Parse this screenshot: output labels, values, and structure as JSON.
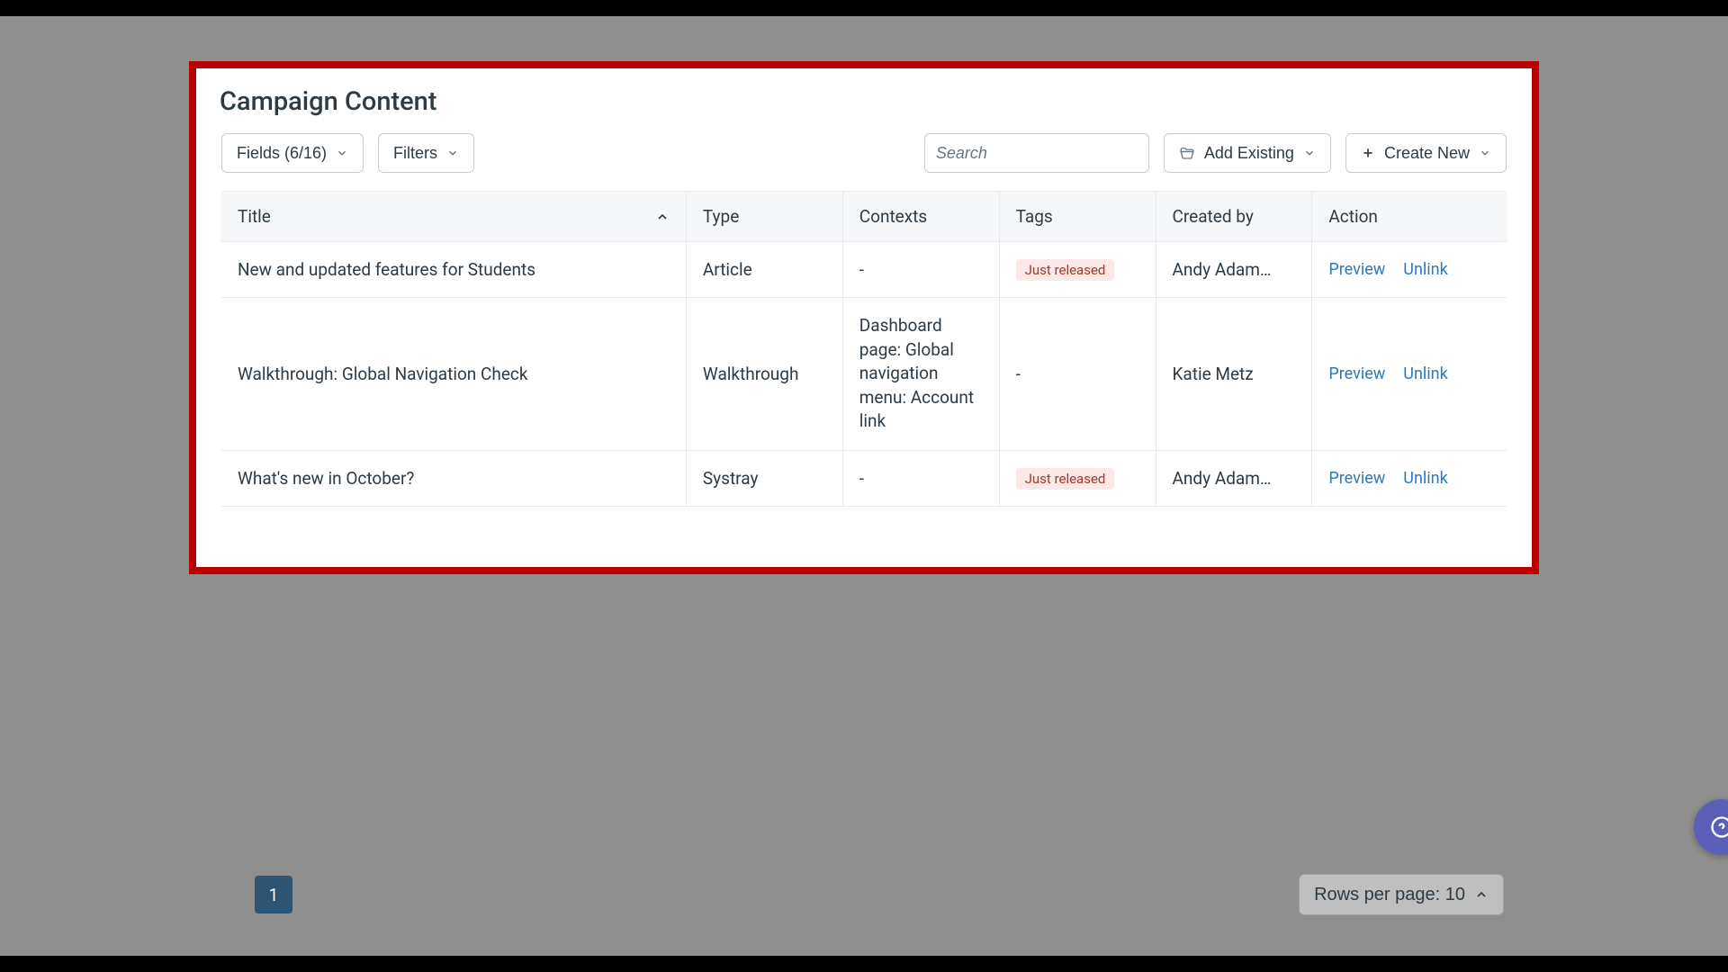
{
  "header": {
    "title": "Campaign Content"
  },
  "toolbar": {
    "fields_label": "Fields (6/16)",
    "filters_label": "Filters",
    "search_placeholder": "Search",
    "add_existing_label": "Add Existing",
    "create_new_label": "Create New"
  },
  "table": {
    "columns": {
      "title": "Title",
      "type": "Type",
      "contexts": "Contexts",
      "tags": "Tags",
      "created_by": "Created by",
      "action": "Action"
    },
    "actions": {
      "preview": "Preview",
      "unlink": "Unlink"
    },
    "rows": [
      {
        "title": "New and updated features for Students",
        "type": "Article",
        "contexts": "-",
        "tag": "Just released",
        "created_by": "Andy Adam…"
      },
      {
        "title": "Walkthrough: Global Navigation Check",
        "type": "Walkthrough",
        "contexts": "Dashboard page: Global navigation menu: Account link",
        "tag": "-",
        "created_by": "Katie Metz"
      },
      {
        "title": "What's new in October?",
        "type": "Systray",
        "contexts": "-",
        "tag": "Just released",
        "created_by": "Andy Adam…"
      }
    ]
  },
  "pagination": {
    "current_page": "1",
    "rows_per_page_label": "Rows per page: 10"
  }
}
